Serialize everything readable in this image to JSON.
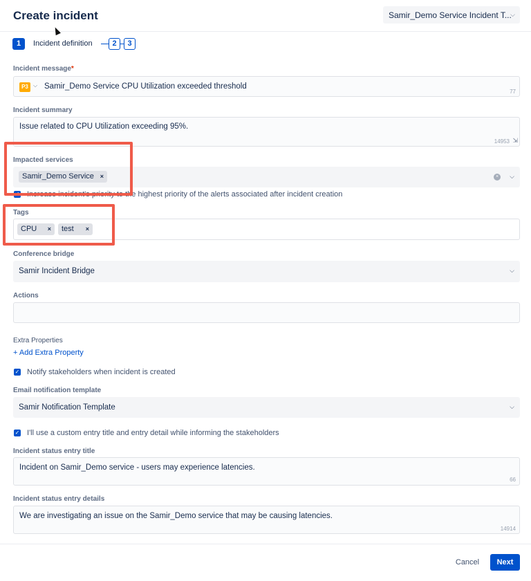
{
  "header": {
    "title": "Create incident",
    "template_select": "Samir_Demo Service Incident T..."
  },
  "steps": {
    "step1_num": "1",
    "step1_label": "Incident definition",
    "step2_num": "2",
    "step3_num": "3"
  },
  "incident_message": {
    "label": "Incident message",
    "required_mark": "*",
    "priority": "P3",
    "value": "Samir_Demo Service CPU Utilization exceeded threshold",
    "counter": "77"
  },
  "incident_summary": {
    "label": "Incident summary",
    "value": "Issue related to CPU Utilization exceeding 95%.",
    "counter": "14953"
  },
  "impacted_services": {
    "label": "Impacted services",
    "chips": [
      "Samir_Demo Service"
    ],
    "checkbox_label": "Increase incident's priority to the highest priority of the alerts associated after incident creation"
  },
  "tags": {
    "label": "Tags",
    "chips": [
      "CPU",
      "test"
    ]
  },
  "conference_bridge": {
    "label": "Conference bridge",
    "value": "Samir Incident Bridge"
  },
  "actions": {
    "label": "Actions",
    "value": ""
  },
  "extra_properties": {
    "label": "Extra Properties",
    "link": "+ Add Extra Property"
  },
  "notify": {
    "label": "Notify stakeholders when incident is created"
  },
  "email_template": {
    "label": "Email notification template",
    "value": "Samir Notification Template"
  },
  "custom_entry": {
    "label": "I'll use a custom entry title and entry detail while informing the stakeholders"
  },
  "status_title": {
    "label": "Incident status entry title",
    "value": "Incident on Samir_Demo service - users may experience latencies.",
    "counter": "66"
  },
  "status_details": {
    "label": "Incident status entry details",
    "value": "We are investigating an issue on the Samir_Demo service that may be causing latencies.",
    "counter": "14914"
  },
  "footer": {
    "cancel": "Cancel",
    "next": "Next"
  },
  "colors": {
    "primary": "#0052cc",
    "highlight": "#ef5b4a",
    "priority_p3": "#ffab00"
  }
}
